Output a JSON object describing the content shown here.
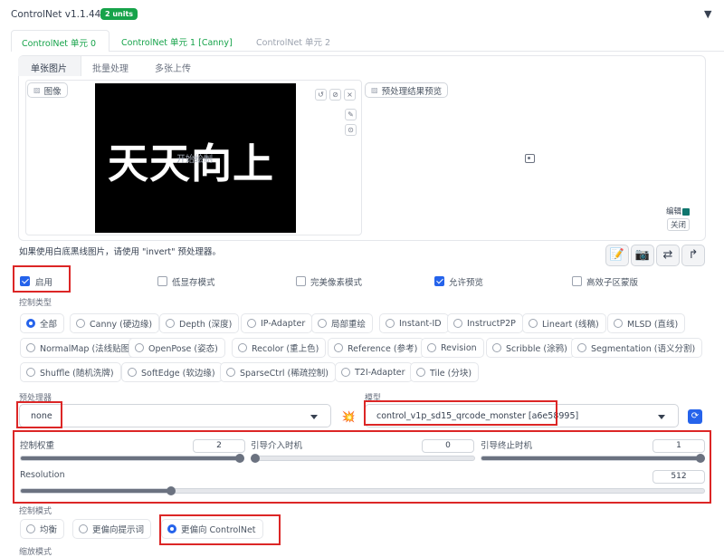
{
  "header": {
    "title": "ControlNet v1.1.449",
    "badge": "2 units",
    "collapse_glyph": "▼"
  },
  "unit_tabs": [
    {
      "label": "ControlNet 单元 0",
      "state": "active"
    },
    {
      "label": "ControlNet 单元 1 [Canny]",
      "state": "configured"
    },
    {
      "label": "ControlNet 单元 2",
      "state": "inactive"
    }
  ],
  "input_tabs": [
    {
      "label": "单张图片"
    },
    {
      "label": "批量处理"
    },
    {
      "label": "多张上传"
    }
  ],
  "image_panel": {
    "label": "图像",
    "image_text": "天天向上",
    "overlay_text": "开始绘制",
    "tool_icons": [
      "↺",
      "⊘",
      "×"
    ],
    "side_icons": [
      "✎",
      "⊙"
    ]
  },
  "preview_panel": {
    "label": "预处理结果预览",
    "edit_label": "编辑",
    "close_label": "关闭"
  },
  "hint_text": "如果使用白底黑线图片，请使用 \"invert\" 预处理器。",
  "tool_buttons": [
    "📝",
    "📷",
    "⇄",
    "↱"
  ],
  "options": [
    {
      "label": "启用",
      "checked": true
    },
    {
      "label": "低显存模式",
      "checked": false
    },
    {
      "label": "完美像素模式",
      "checked": false
    },
    {
      "label": "允许预览",
      "checked": true
    },
    {
      "label": "高效子区蒙版",
      "checked": false
    }
  ],
  "control_type": {
    "label": "控制类型",
    "rows": [
      [
        {
          "label": "全部",
          "selected": true
        },
        {
          "label": "Canny (硬边缘)",
          "selected": false
        },
        {
          "label": "Depth (深度)",
          "selected": false
        },
        {
          "label": "IP-Adapter",
          "selected": false
        },
        {
          "label": "局部重绘",
          "selected": false
        },
        {
          "label": "Instant-ID",
          "selected": false
        },
        {
          "label": "InstructP2P",
          "selected": false
        },
        {
          "label": "Lineart (线稿)",
          "selected": false
        },
        {
          "label": "MLSD (直线)",
          "selected": false
        }
      ],
      [
        {
          "label": "NormalMap (法线贴图)",
          "selected": false
        },
        {
          "label": "OpenPose (姿态)",
          "selected": false
        },
        {
          "label": "Recolor (重上色)",
          "selected": false
        },
        {
          "label": "Reference (参考)",
          "selected": false
        },
        {
          "label": "Revision",
          "selected": false
        },
        {
          "label": "Scribble (涂鸦)",
          "selected": false
        },
        {
          "label": "Segmentation (语义分割)",
          "selected": false
        }
      ],
      [
        {
          "label": "Shuffle (随机洗牌)",
          "selected": false
        },
        {
          "label": "SoftEdge (软边缘)",
          "selected": false
        },
        {
          "label": "SparseCtrl (稀疏控制)",
          "selected": false
        },
        {
          "label": "T2I-Adapter",
          "selected": false
        },
        {
          "label": "Tile (分块)",
          "selected": false
        }
      ]
    ]
  },
  "preprocessor": {
    "label": "预处理器",
    "value": "none"
  },
  "model": {
    "label": "模型",
    "value": "control_v1p_sd15_qrcode_monster [a6e58995]"
  },
  "sliders": {
    "weight": {
      "label": "控制权重",
      "value": "2",
      "fraction": 1.0
    },
    "start": {
      "label": "引导介入时机",
      "value": "0",
      "fraction": 0.0
    },
    "end": {
      "label": "引导终止时机",
      "value": "1",
      "fraction": 1.0
    },
    "resolution": {
      "label": "Resolution",
      "value": "512",
      "fraction": 0.22
    }
  },
  "control_mode": {
    "label": "控制模式",
    "options": [
      {
        "label": "均衡",
        "selected": false
      },
      {
        "label": "更偏向提示词",
        "selected": false
      },
      {
        "label": "更偏向 ControlNet",
        "selected": true
      }
    ]
  },
  "resize_mode": {
    "label": "缩放模式"
  },
  "colors": {
    "accent": "#2563eb",
    "badge": "#16a34a",
    "highlight": "#dc2626"
  }
}
